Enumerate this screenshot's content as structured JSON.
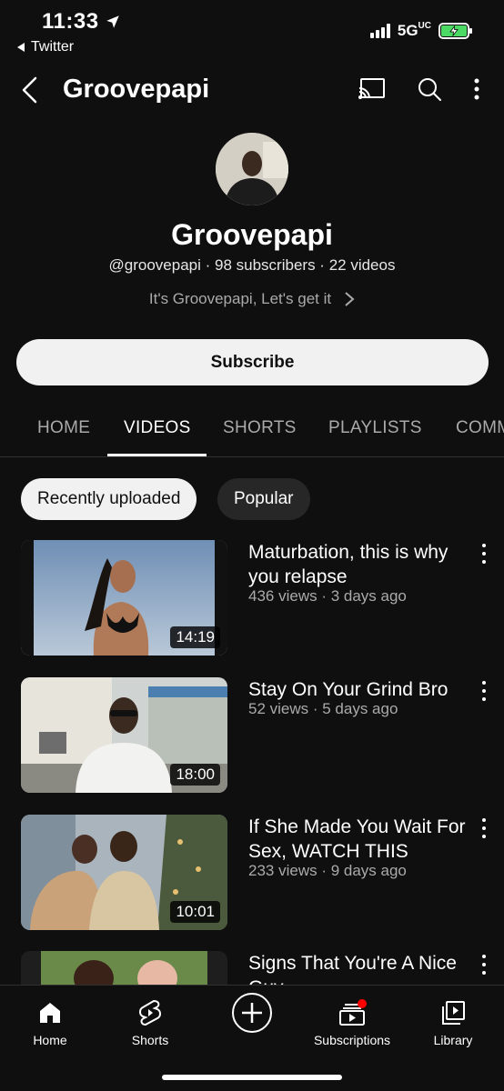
{
  "status_bar": {
    "time": "11:33",
    "back_app": "Twitter",
    "network": "5G",
    "network_suffix": "UC"
  },
  "header": {
    "title": "Groovepapi"
  },
  "channel": {
    "name": "Groovepapi",
    "handle": "@groovepapi",
    "subscribers": "98 subscribers",
    "videos_count": "22 videos",
    "separator": " · ",
    "tagline": "It's Groovepapi, Let's get it"
  },
  "subscribe_label": "Subscribe",
  "tabs": [
    {
      "label": "HOME"
    },
    {
      "label": "VIDEOS"
    },
    {
      "label": "SHORTS"
    },
    {
      "label": "PLAYLISTS"
    },
    {
      "label": "COMM"
    }
  ],
  "chips": {
    "selected": "Recently uploaded",
    "other": "Popular"
  },
  "videos": [
    {
      "title": "Maturbation, this is why you relapse",
      "meta": "436 views · 3 days ago",
      "duration": "14:19"
    },
    {
      "title": "Stay On Your Grind Bro",
      "meta": "52 views · 5 days ago",
      "duration": "18:00"
    },
    {
      "title": "If She Made You Wait For Sex, WATCH THIS",
      "meta": "233 views · 9 days ago",
      "duration": "10:01"
    },
    {
      "title": "Signs That You're A Nice Guy",
      "meta": "",
      "duration": ""
    }
  ],
  "bottom_nav": [
    {
      "label": "Home",
      "icon": "home-icon"
    },
    {
      "label": "Shorts",
      "icon": "shorts-icon"
    },
    {
      "label": "",
      "icon": "create-icon"
    },
    {
      "label": "Subscriptions",
      "icon": "subscriptions-icon"
    },
    {
      "label": "Library",
      "icon": "library-icon"
    }
  ],
  "colors": {
    "background": "#0f0f0f",
    "notification_dot": "#ff0000",
    "battery_fill": "#4cd964"
  }
}
